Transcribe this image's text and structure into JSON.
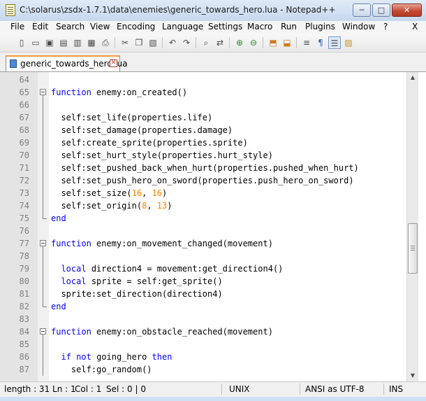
{
  "window": {
    "title": "C:\\solarus\\zsdx-1.7.1\\data\\enemies\\generic_towards_hero.lua - Notepad++",
    "minimize_glyph": "─",
    "maximize_glyph": "□",
    "close_glyph": "✕"
  },
  "menu": [
    "File",
    "Edit",
    "Search",
    "View",
    "Encoding",
    "Language",
    "Settings",
    "Macro",
    "Run",
    "Plugins",
    "Window",
    "?"
  ],
  "menu_close_glyph": "X",
  "toolbar_icons": [
    "new-file-icon",
    "open-file-icon",
    "save-icon",
    "save-all-icon",
    "close-icon",
    "close-all-icon",
    "print-icon",
    "cut-icon",
    "copy-icon",
    "paste-icon",
    "undo-icon",
    "redo-icon",
    "find-icon",
    "replace-icon",
    "zoom-in-icon",
    "zoom-out-icon",
    "sync-vertical-icon",
    "sync-horizontal-icon",
    "word-wrap-icon",
    "show-all-chars-icon",
    "indent-guide-icon",
    "doc-map-icon"
  ],
  "tab": {
    "label": "generic_towards_hero.lua",
    "close_glyph": "✕"
  },
  "code_lines": [
    {
      "n": "64",
      "text": ""
    },
    {
      "n": "65",
      "text": "function enemy:on_created()"
    },
    {
      "n": "66",
      "text": ""
    },
    {
      "n": "67",
      "text": "  self:set_life(properties.life)"
    },
    {
      "n": "68",
      "text": "  self:set_damage(properties.damage)"
    },
    {
      "n": "69",
      "text": "  self:create_sprite(properties.sprite)"
    },
    {
      "n": "70",
      "text": "  self:set_hurt_style(properties.hurt_style)"
    },
    {
      "n": "71",
      "text": "  self:set_pushed_back_when_hurt(properties.pushed_when_hurt)"
    },
    {
      "n": "72",
      "text": "  self:set_push_hero_on_sword(properties.push_hero_on_sword)"
    },
    {
      "n": "73",
      "text": "  self:set_size(16, 16)"
    },
    {
      "n": "74",
      "text": "  self:set_origin(8, 13)"
    },
    {
      "n": "75",
      "text": "end"
    },
    {
      "n": "76",
      "text": ""
    },
    {
      "n": "77",
      "text": "function enemy:on_movement_changed(movement)"
    },
    {
      "n": "78",
      "text": ""
    },
    {
      "n": "79",
      "text": "  local direction4 = movement:get_direction4()"
    },
    {
      "n": "80",
      "text": "  local sprite = self:get_sprite()"
    },
    {
      "n": "81",
      "text": "  sprite:set_direction(direction4)"
    },
    {
      "n": "82",
      "text": "end"
    },
    {
      "n": "83",
      "text": ""
    },
    {
      "n": "84",
      "text": "function enemy:on_obstacle_reached(movement)"
    },
    {
      "n": "85",
      "text": ""
    },
    {
      "n": "86",
      "text": "  if not going_hero then"
    },
    {
      "n": "87",
      "text": "    self:go_random()"
    }
  ],
  "syntax": {
    "keywords": [
      "function",
      "end",
      "local",
      "if",
      "not",
      "then"
    ],
    "keyword_color": "#0000ff",
    "number_color": "#ff8000"
  },
  "status": {
    "length_ln": "length : 31  Ln : 1",
    "col": "Col : 1",
    "sel": "Sel : 0 | 0",
    "eol": "UNIX",
    "encoding": "ANSI as UTF-8",
    "mode": "INS"
  }
}
